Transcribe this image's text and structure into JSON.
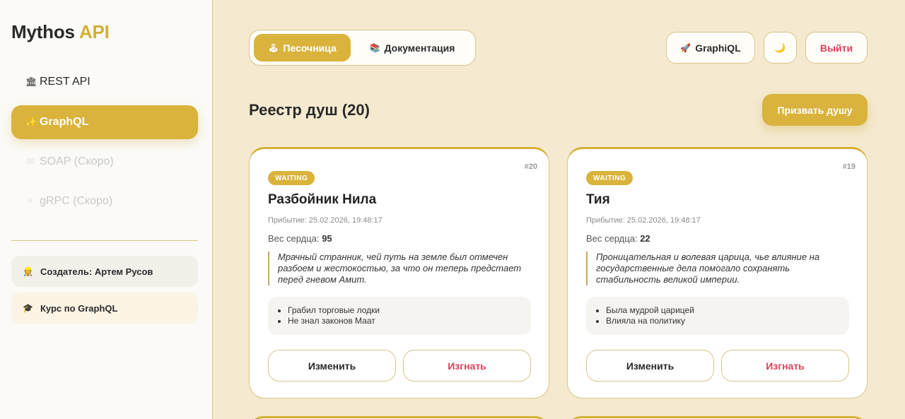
{
  "brand": {
    "name": "Mythos",
    "accent": "API"
  },
  "sidebar": {
    "items": [
      {
        "icon": "classical-building-icon",
        "glyph": "🏛",
        "label": "REST API"
      },
      {
        "icon": "sparkles-icon",
        "glyph": "✨",
        "label": "GraphQL"
      },
      {
        "icon": "envelope-icon",
        "glyph": "✉",
        "label": "SOAP (Скоро)"
      },
      {
        "icon": "lightning-icon",
        "glyph": "⚡",
        "label": "gRPC (Скоро)"
      }
    ],
    "creator": {
      "glyph": "👷",
      "label": "Создатель: Артем Русов"
    },
    "course": {
      "glyph": "🎓",
      "label": "Курс по GraphQL"
    }
  },
  "tabs": {
    "sandbox": {
      "glyph": "🕹",
      "label": "Песочница"
    },
    "docs": {
      "glyph": "📚",
      "label": "Документация"
    }
  },
  "header": {
    "graphiql": {
      "glyph": "🚀",
      "label": "GraphiQL"
    },
    "theme_glyph": "🌙",
    "logout": "Выйти"
  },
  "registry": {
    "title": "Реестр душ (20)",
    "summon": "Призвать душу"
  },
  "souls": [
    {
      "status": "WAITING",
      "number": "#20",
      "name": "Разбойник Нила",
      "arrival": "Прибытие: 25.02.2026, 19:48:17",
      "weight_label": "Вес сердца:",
      "weight": "95",
      "description": "Мрачный странник, чей путь на земле был отмечен разбоем и жестокостью, за что он теперь предстает перед гневом Амит.",
      "traits": [
        "Грабил торговые лодки",
        "Не знал законов Маат"
      ],
      "edit": "Изменить",
      "banish": "Изгнать"
    },
    {
      "status": "WAITING",
      "number": "#19",
      "name": "Тия",
      "arrival": "Прибытие: 25.02.2026, 19:48:17",
      "weight_label": "Вес сердца:",
      "weight": "22",
      "description": "Проницательная и волевая царица, чье влияние на государственные дела помогало сохранять стабильность великой империи.",
      "traits": [
        "Была мудрой царицей",
        "Влияла на политику"
      ],
      "edit": "Изменить",
      "banish": "Изгнать"
    }
  ],
  "colors": {
    "accent": "#d9b33c",
    "background": "#f5ead0",
    "danger": "#e0405a"
  }
}
